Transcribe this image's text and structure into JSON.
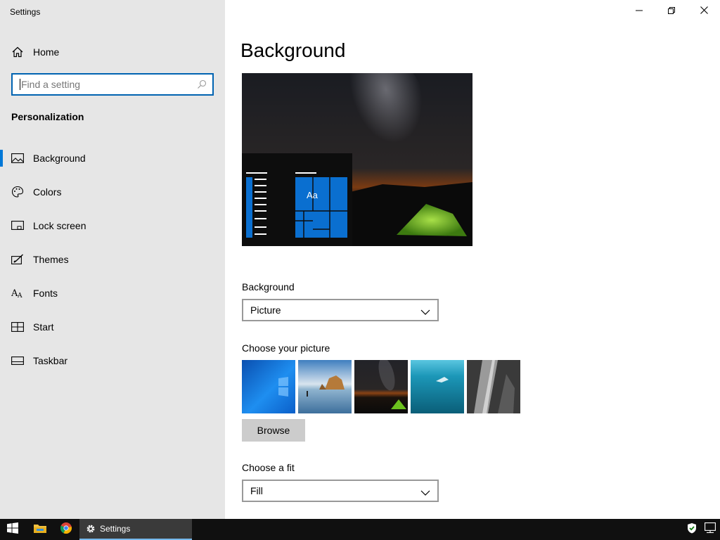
{
  "window": {
    "title": "Settings"
  },
  "sidebar": {
    "home_label": "Home",
    "search_placeholder": "Find a setting",
    "section_title": "Personalization",
    "items": [
      {
        "label": "Background",
        "icon": "picture-icon",
        "active": true
      },
      {
        "label": "Colors",
        "icon": "palette-icon",
        "active": false
      },
      {
        "label": "Lock screen",
        "icon": "lock-screen-icon",
        "active": false
      },
      {
        "label": "Themes",
        "icon": "themes-icon",
        "active": false
      },
      {
        "label": "Fonts",
        "icon": "fonts-icon",
        "active": false
      },
      {
        "label": "Start",
        "icon": "start-icon",
        "active": false
      },
      {
        "label": "Taskbar",
        "icon": "taskbar-icon",
        "active": false
      }
    ]
  },
  "main": {
    "title": "Background",
    "preview": {
      "tile_label": "Aa"
    },
    "background_label": "Background",
    "background_value": "Picture",
    "choose_picture_label": "Choose your picture",
    "pictures": [
      "windows-blue",
      "beach-rocks",
      "night-sky-tent",
      "underwater-swimmer",
      "rock-cliff"
    ],
    "browse_label": "Browse",
    "choose_fit_label": "Choose a fit",
    "fit_value": "Fill"
  },
  "taskbar": {
    "active_app": "Settings"
  },
  "colors": {
    "accent": "#0078d7",
    "sidebar_bg": "#e6e6e6",
    "taskbar_bg": "#101010"
  }
}
